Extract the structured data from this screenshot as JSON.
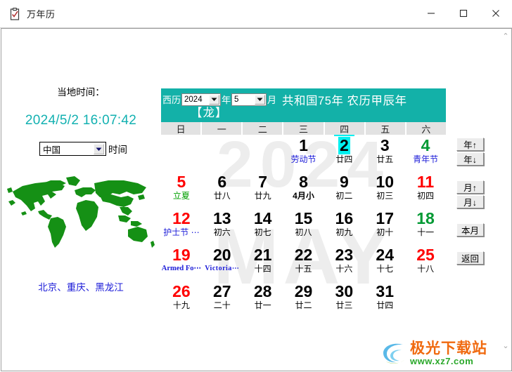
{
  "window": {
    "title": "万年历",
    "icon": "calendar-clipboard-icon",
    "controls": {
      "minimize": "−",
      "maximize": "□",
      "close": "✕"
    }
  },
  "left_panel": {
    "local_time_label": "当地时间：",
    "local_time_value": "2024/5/2 16:07:42",
    "timezone_select": {
      "value": "中国",
      "label": "时间"
    },
    "map_icon": "world-map-icon",
    "cities": "北京、重庆、黑龙江"
  },
  "calendar": {
    "header": {
      "prefix": "西历",
      "year_value": "2024",
      "year_suffix": "年",
      "month_value": "5",
      "month_suffix": "月",
      "era_text": "共和国75年  农历甲辰年",
      "zodiac_text": "【龙】",
      "bg_color": "#13b1a8"
    },
    "weekdays": [
      "日",
      "一",
      "二",
      "三",
      "四",
      "五",
      "六"
    ],
    "today_column_index": 4,
    "watermark_year": "2024",
    "watermark_month": "MAY",
    "weeks": [
      [
        {
          "day": "",
          "sub": ""
        },
        {
          "day": "",
          "sub": ""
        },
        {
          "day": "",
          "sub": ""
        },
        {
          "day": "1",
          "color": "black",
          "sub": "劳动节",
          "sub_color": "blue"
        },
        {
          "day": "2",
          "color": "today",
          "sub": "廿四",
          "sub_color": "black"
        },
        {
          "day": "3",
          "color": "black",
          "sub": "廿五",
          "sub_color": "black"
        },
        {
          "day": "4",
          "color": "green",
          "sub": "青年节",
          "sub_color": "blue"
        }
      ],
      [
        {
          "day": "5",
          "color": "red",
          "sub": "立夏",
          "sub_color": "green"
        },
        {
          "day": "6",
          "color": "black",
          "sub": "廿八",
          "sub_color": "black"
        },
        {
          "day": "7",
          "color": "black",
          "sub": "廿九",
          "sub_color": "black"
        },
        {
          "day": "8",
          "color": "black",
          "sub": "4月小",
          "sub_color": "bold"
        },
        {
          "day": "9",
          "color": "black",
          "sub": "初二",
          "sub_color": "black"
        },
        {
          "day": "10",
          "color": "black",
          "sub": "初三",
          "sub_color": "black"
        },
        {
          "day": "11",
          "color": "red",
          "sub": "初四",
          "sub_color": "black"
        }
      ],
      [
        {
          "day": "12",
          "color": "red",
          "sub": "护士节 ⋯",
          "sub_color": "blue"
        },
        {
          "day": "13",
          "color": "black",
          "sub": "初六",
          "sub_color": "black"
        },
        {
          "day": "14",
          "color": "black",
          "sub": "初七",
          "sub_color": "black"
        },
        {
          "day": "15",
          "color": "black",
          "sub": "初八",
          "sub_color": "black"
        },
        {
          "day": "16",
          "color": "black",
          "sub": "初九",
          "sub_color": "black"
        },
        {
          "day": "17",
          "color": "black",
          "sub": "初十",
          "sub_color": "black"
        },
        {
          "day": "18",
          "color": "green",
          "sub": "十一",
          "sub_color": "black"
        }
      ],
      [
        {
          "day": "19",
          "color": "red",
          "sub": "Armed Fo⋯",
          "sub_color": "serif"
        },
        {
          "day": "20",
          "color": "black",
          "sub": "Victoria⋯",
          "sub_color": "tiny"
        },
        {
          "day": "21",
          "color": "black",
          "sub": "十四",
          "sub_color": "black"
        },
        {
          "day": "22",
          "color": "black",
          "sub": "十五",
          "sub_color": "black"
        },
        {
          "day": "23",
          "color": "black",
          "sub": "十六",
          "sub_color": "black"
        },
        {
          "day": "24",
          "color": "black",
          "sub": "十七",
          "sub_color": "black"
        },
        {
          "day": "25",
          "color": "red",
          "sub": "十八",
          "sub_color": "black"
        }
      ],
      [
        {
          "day": "26",
          "color": "red",
          "sub": "十九",
          "sub_color": "black"
        },
        {
          "day": "27",
          "color": "black",
          "sub": "二十",
          "sub_color": "black"
        },
        {
          "day": "28",
          "color": "black",
          "sub": "廿一",
          "sub_color": "black"
        },
        {
          "day": "29",
          "color": "black",
          "sub": "廿二",
          "sub_color": "black"
        },
        {
          "day": "30",
          "color": "black",
          "sub": "廿三",
          "sub_color": "black"
        },
        {
          "day": "31",
          "color": "black",
          "sub": "廿四",
          "sub_color": "black"
        },
        {
          "day": "",
          "sub": ""
        }
      ]
    ]
  },
  "side_buttons": [
    {
      "label": "年↑",
      "name": "year-up-button"
    },
    {
      "label": "年↓",
      "name": "year-down-button"
    },
    {
      "label": "月↑",
      "name": "month-up-button"
    },
    {
      "label": "月↓",
      "name": "month-down-button"
    },
    {
      "label": "本月",
      "name": "this-month-button"
    },
    {
      "label": "返回",
      "name": "back-button"
    }
  ],
  "scrollbar": {
    "up_arrow": "⌃",
    "down_arrow": "⌄"
  },
  "logo": {
    "name_cn": "极光下载站",
    "url": "www.xz7.com"
  }
}
